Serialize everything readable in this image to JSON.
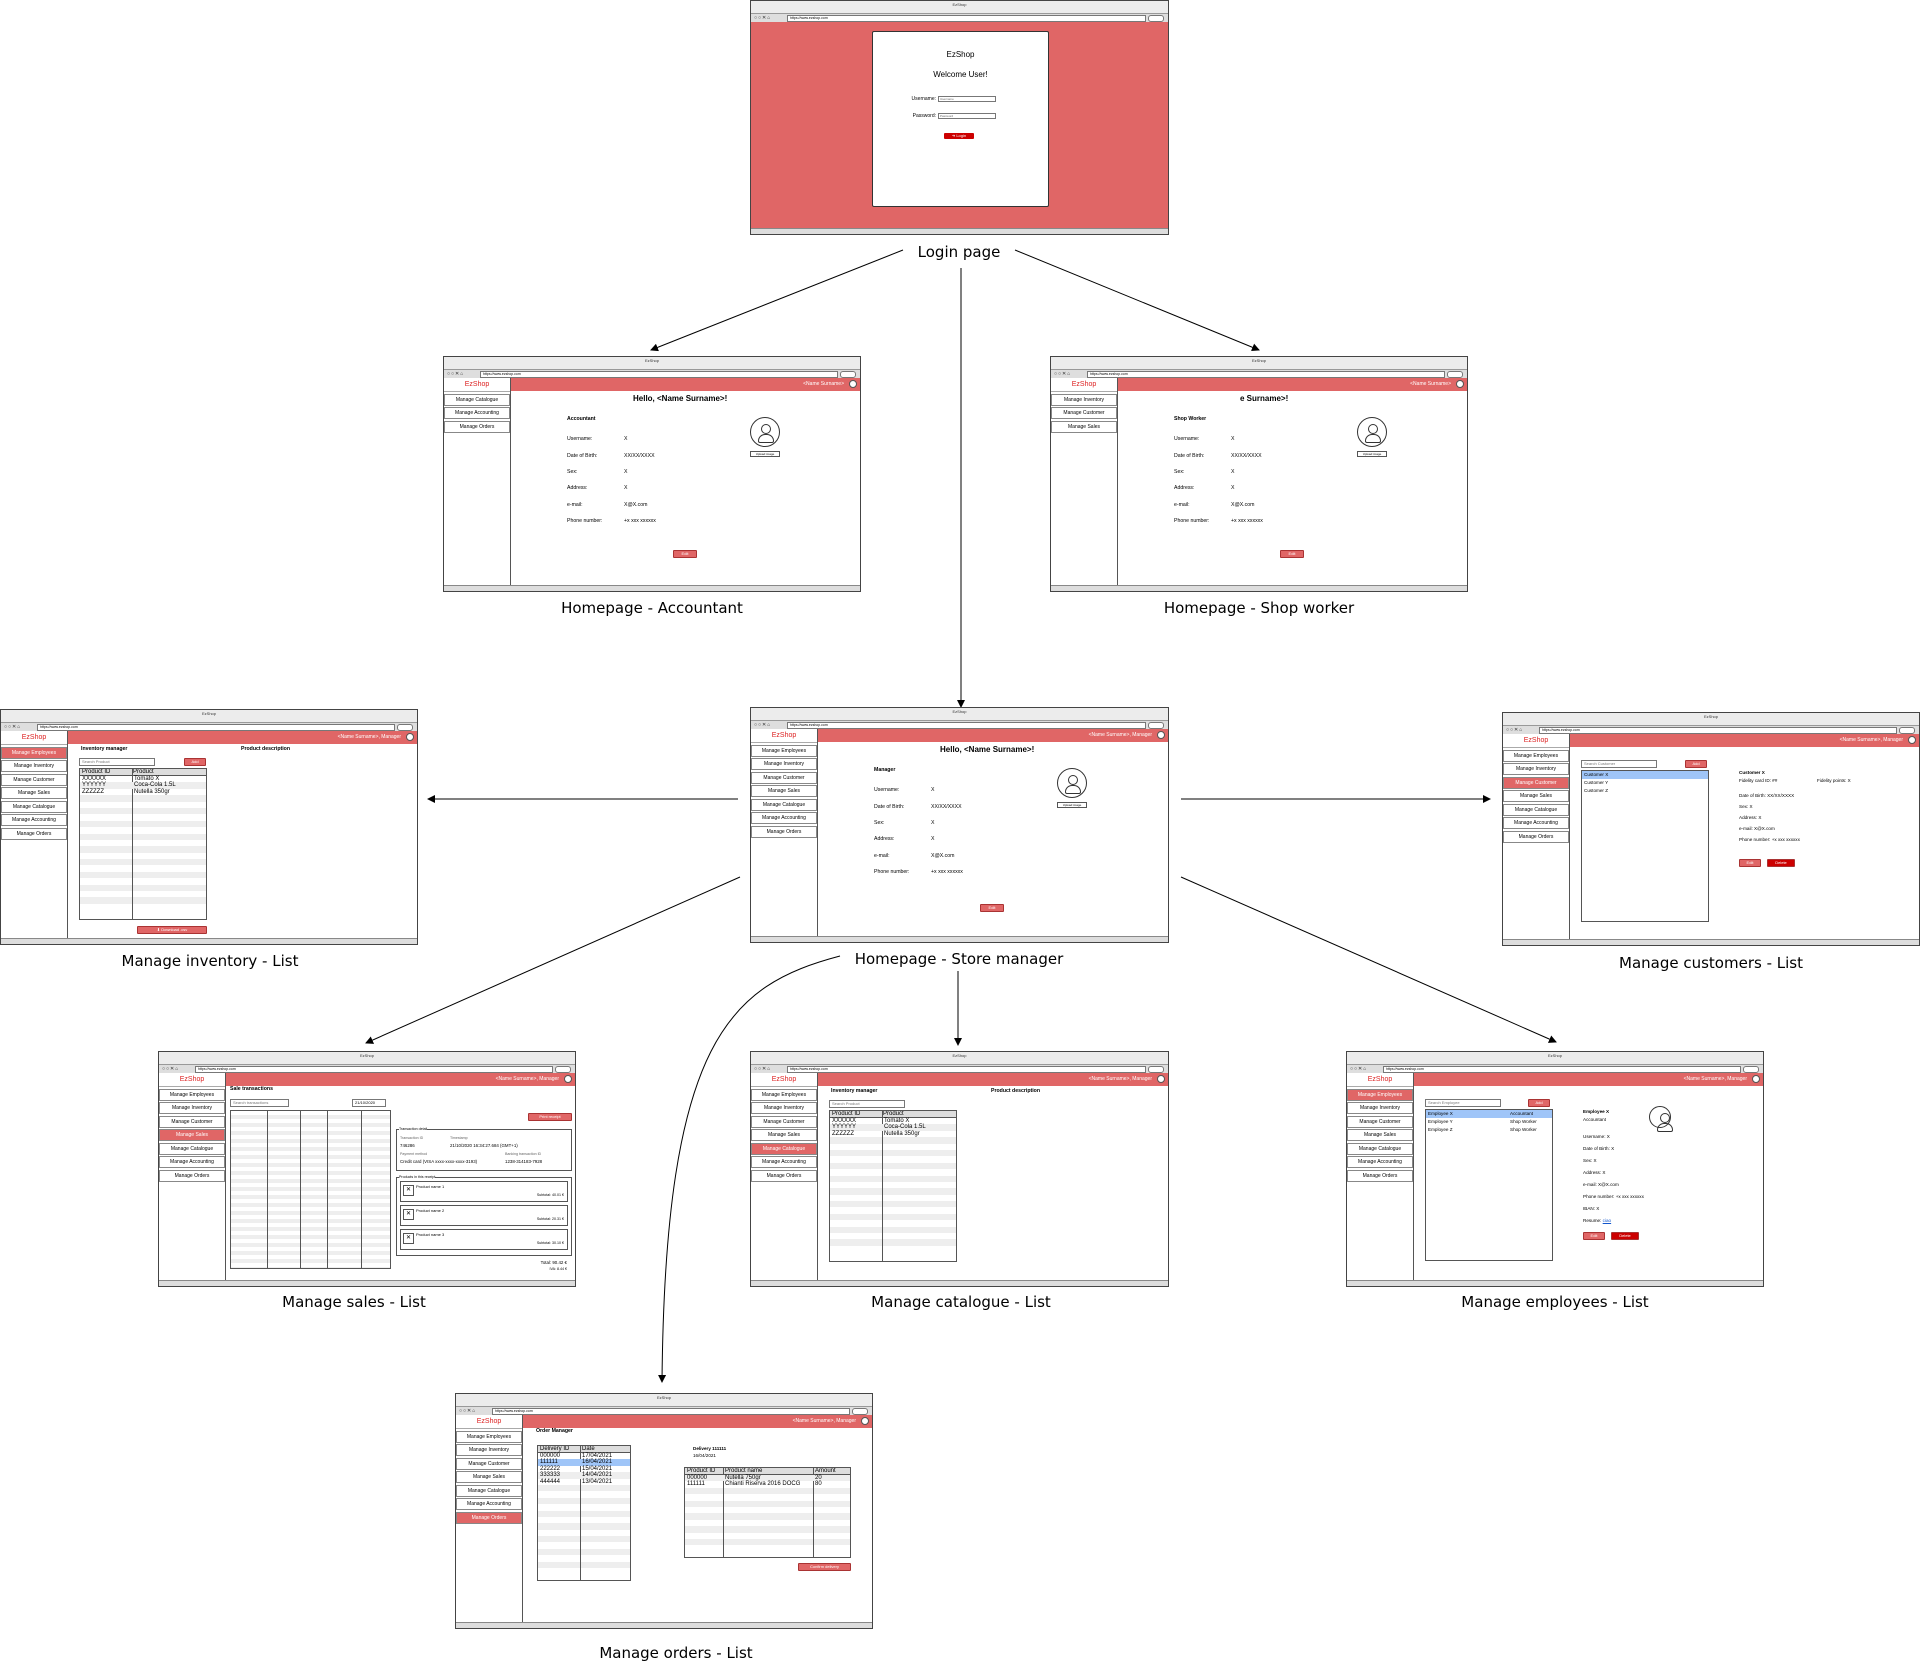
{
  "captions": {
    "login": "Login page",
    "home_accountant": "Homepage - Accountant",
    "home_shopworker": "Homepage - Shop worker",
    "home_manager": "Homepage - Store manager",
    "inventory": "Manage inventory - List",
    "customers": "Manage customers - List",
    "sales": "Manage sales - List",
    "catalogue": "Manage catalogue - List",
    "employees": "Manage employees - List",
    "orders": "Manage orders - List"
  },
  "browser": {
    "title": "EzShop",
    "url": "https://www.ezshop.com"
  },
  "app": {
    "logo": "EzShop",
    "user_label": "<Name Surname>",
    "user_label_manager": "<Name Surname>, Manager"
  },
  "login": {
    "title": "EzShop",
    "welcome": "Welcome User!",
    "username_label": "Username:",
    "password_label": "Password:",
    "username_placeholder": "Username",
    "password_placeholder": "Password",
    "login_button": "Login"
  },
  "menus": {
    "accountant": [
      "Manage Catalogue",
      "Manage Accounting",
      "Manage Orders"
    ],
    "shopworker": [
      "Manage Inventory",
      "Manage Customer",
      "Manage Sales"
    ],
    "manager": [
      "Manage Employees",
      "Manage Inventory",
      "Manage Customer",
      "Manage Sales",
      "Manage Catalogue",
      "Manage Accounting",
      "Manage Orders"
    ]
  },
  "profile": {
    "greeting": "Hello, <Name Surname>!",
    "greeting_partial": "e Surname>!",
    "role_accountant": "Accountant",
    "role_shopworker": "Shop Worker",
    "role_manager": "Manager",
    "labels": [
      "Username:",
      "Date of Birth:",
      "Sex:",
      "Address:",
      "e-mail:",
      "Phone number:"
    ],
    "values": [
      "X",
      "XX/XX/XXXX",
      "X",
      "X",
      "X@X.com",
      "+x xxx xxxxxx"
    ],
    "upload": "Upload image",
    "edit": "Edit"
  },
  "inventory": {
    "title": "Inventory manager",
    "desc_title": "Product description",
    "search": "Search Product",
    "add": "Add",
    "headers": [
      "Product ID",
      "Product"
    ],
    "rows": [
      [
        "XXXXXX",
        "Tomato X"
      ],
      [
        "YYYYYY",
        "Coca-Cola 1.5L"
      ],
      [
        "ZZZZZZ",
        "Nutella 350gr"
      ]
    ],
    "download": "Download .csv"
  },
  "customers": {
    "search": "Search Customer",
    "add": "Add",
    "list": [
      "Customer X",
      "Customer Y",
      "Customer Z"
    ],
    "detail_title": "Customer X",
    "card": "Fidelity card ID: ##",
    "points": "Fidelity points: X",
    "dob": "Date of Birth: XX/XX/XXXX",
    "sex": "Sex: X",
    "address": "Address: X",
    "email": "e-mail: X@X.com",
    "phone": "Phone number: +x xxx xxxxxx",
    "edit": "Edit",
    "delete": "Delete"
  },
  "sales": {
    "title": "Sale transactions",
    "search": "Search transactions",
    "date": "21/10/2020",
    "print": "Print receipt",
    "detail_hdr": "Transaction detail",
    "id_label": "Transaction ID",
    "id_value": "746286",
    "ts_label": "Timestamp",
    "ts_value": "21/10/2020 16:34:27.684 (GMT+1)",
    "pay_label": "Payment method",
    "pay_value": "Credit card (VISA xxxx-xxxx-xxxx-3193)",
    "ext_label": "Banking transaction ID",
    "ext_value": "1238-314183-7928",
    "items_hdr": "Products in this receipt",
    "items": [
      {
        "name": "Product name 1",
        "sub": "Subtotal: 40.01 €"
      },
      {
        "name": "Product name 2",
        "sub": "Subtotal: 20.31 €"
      },
      {
        "name": "Product name 3",
        "sub": "Subtotal: 30.10 €"
      }
    ],
    "total": "Total: 90.42 €",
    "vat": "IVA: 8.44 €"
  },
  "catalogue": {
    "title": "Inventory manager",
    "desc_title": "Product description",
    "search": "Search Product",
    "headers": [
      "Product ID",
      "Product"
    ],
    "rows": [
      [
        "XXXXXX",
        "Tomato X"
      ],
      [
        "YYYYYY",
        "Coca-Cola 1.5L"
      ],
      [
        "ZZZZZZ",
        "Nutella 350gr"
      ]
    ]
  },
  "employees": {
    "search": "Search Employee",
    "add": "Add",
    "list": [
      [
        "Employee X",
        "Accountant"
      ],
      [
        "Employee Y",
        "Shop Worker"
      ],
      [
        "Employee Z",
        "Shop Worker"
      ]
    ],
    "detail_title": "Employee X",
    "detail_role": "Accountant",
    "fields": [
      "Username: X",
      "Date of Birth: X",
      "Sex: X",
      "Address: X",
      "e-mail: X@X.com",
      "Phone number: +x xxx xxxxxx",
      "IBAN: X"
    ],
    "resume_label": "Resume:",
    "resume_link": "ciao",
    "edit": "Edit",
    "delete": "Delete"
  },
  "orders": {
    "title": "Order Manager",
    "headers": [
      "Delivery ID",
      "Date"
    ],
    "rows": [
      [
        "000000",
        "17/04/2021"
      ],
      [
        "111111",
        "16/04/2021"
      ],
      [
        "222222",
        "15/04/2021"
      ],
      [
        "333333",
        "14/04/2021"
      ],
      [
        "444444",
        "13/04/2021"
      ]
    ],
    "delivery_title": "Delivery 111111",
    "delivery_date": "16/04/2021",
    "prod_headers": [
      "Product ID",
      "Product name",
      "Amount"
    ],
    "prod_rows": [
      [
        "000000",
        "Nutella 750gr",
        "20"
      ],
      [
        "111111",
        "Chianti Riserva 2016 DOCG",
        "80"
      ]
    ],
    "confirm": "Confirm delivery"
  }
}
